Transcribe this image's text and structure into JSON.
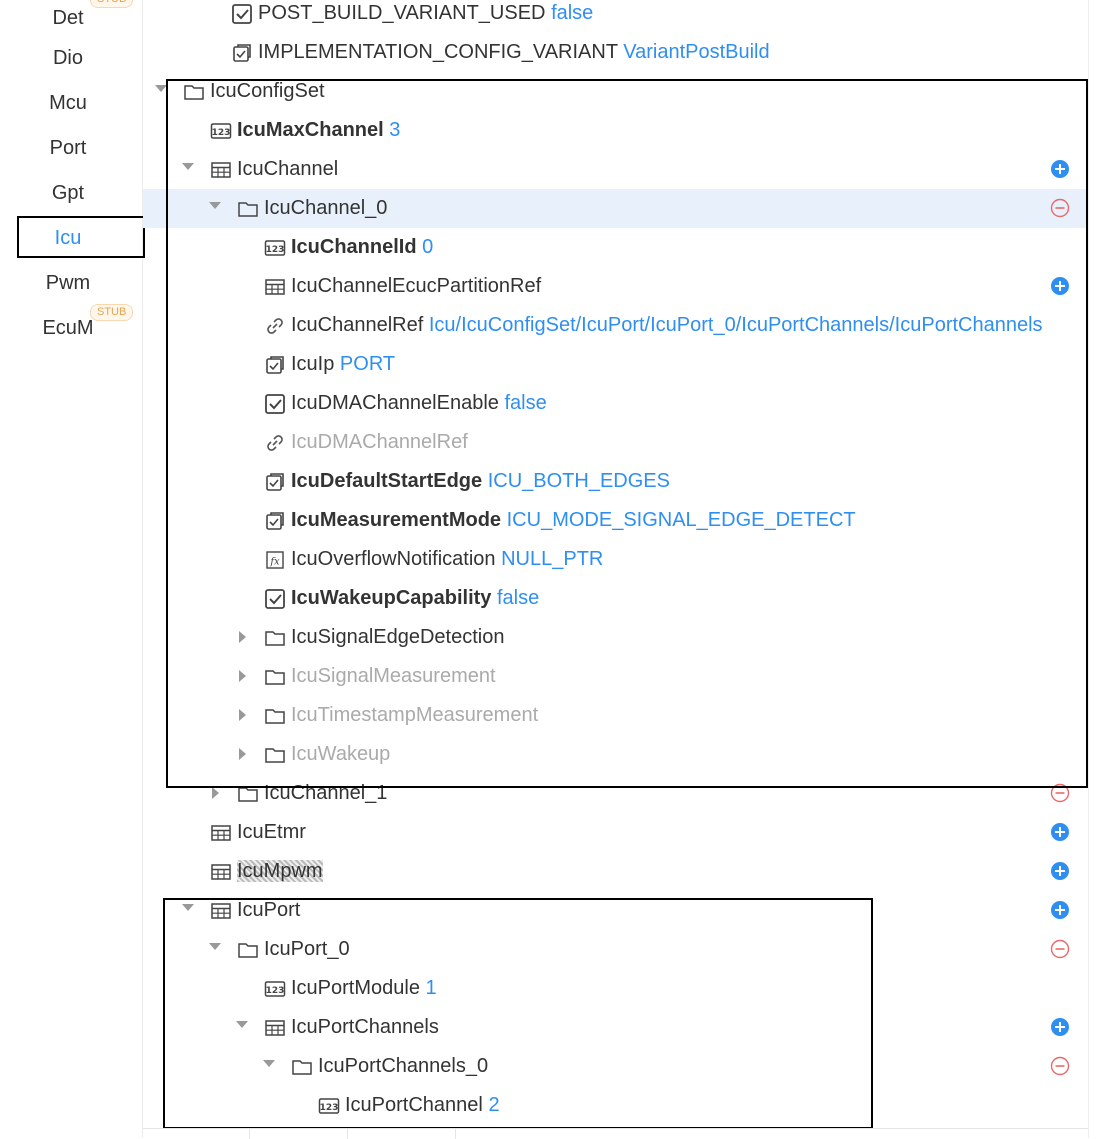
{
  "sidebar": {
    "items": [
      {
        "label": "Det",
        "stub": true
      },
      {
        "label": "Dio",
        "stub": false
      },
      {
        "label": "Mcu",
        "stub": false
      },
      {
        "label": "Port",
        "stub": false
      },
      {
        "label": "Gpt",
        "stub": false
      },
      {
        "label": "Icu",
        "stub": false,
        "active": true
      },
      {
        "label": "Pwm",
        "stub": false
      },
      {
        "label": "EcuM",
        "stub": true
      }
    ],
    "stub_label": "STUB"
  },
  "tree": [
    {
      "label": "POST_BUILD_VARIANT_USED",
      "value": "false",
      "icon": "checkbox-icon"
    },
    {
      "label": "IMPLEMENTATION_CONFIG_VARIANT",
      "value": "VariantPostBuild",
      "icon": "enum-icon"
    },
    {
      "label": "IcuConfigSet",
      "value": "",
      "icon": "folder-icon",
      "expanded": true
    },
    {
      "label": "IcuMaxChannel",
      "value": "3",
      "icon": "number-icon",
      "bold": true
    },
    {
      "label": "IcuChannel",
      "value": "",
      "icon": "table-icon",
      "expanded": true,
      "action": "add"
    },
    {
      "label": "IcuChannel_0",
      "value": "",
      "icon": "folder-icon",
      "expanded": true,
      "action": "remove",
      "selected": true
    },
    {
      "label": "IcuChannelId",
      "value": "0",
      "icon": "number-icon",
      "bold": true
    },
    {
      "label": "IcuChannelEcucPartitionRef",
      "value": "",
      "icon": "table-icon",
      "action": "add"
    },
    {
      "label": "IcuChannelRef",
      "value": "Icu/IcuConfigSet/IcuPort/IcuPort_0/IcuPortChannels/IcuPortChannels",
      "icon": "link-icon"
    },
    {
      "label": "IcuIp",
      "value": "PORT",
      "icon": "enum-icon"
    },
    {
      "label": "IcuDMAChannelEnable",
      "value": "false",
      "icon": "checkbox-icon"
    },
    {
      "label": "IcuDMAChannelRef",
      "value": "",
      "icon": "link-icon",
      "dim": true
    },
    {
      "label": "IcuDefaultStartEdge",
      "value": "ICU_BOTH_EDGES",
      "icon": "enum-icon",
      "bold": true
    },
    {
      "label": "IcuMeasurementMode",
      "value": "ICU_MODE_SIGNAL_EDGE_DETECT",
      "icon": "enum-icon",
      "bold": true
    },
    {
      "label": "IcuOverflowNotification",
      "value": "NULL_PTR",
      "icon": "function-icon"
    },
    {
      "label": "IcuWakeupCapability",
      "value": "false",
      "icon": "checkbox-icon",
      "bold": true
    },
    {
      "label": "IcuSignalEdgeDetection",
      "value": "",
      "icon": "folder-icon",
      "collapsed": true
    },
    {
      "label": "IcuSignalMeasurement",
      "value": "",
      "icon": "folder-icon",
      "collapsed": true,
      "dim": true
    },
    {
      "label": "IcuTimestampMeasurement",
      "value": "",
      "icon": "folder-icon",
      "collapsed": true,
      "dim": true
    },
    {
      "label": "IcuWakeup",
      "value": "",
      "icon": "folder-icon",
      "collapsed": true,
      "dim": true
    },
    {
      "label": "IcuChannel_1",
      "value": "",
      "icon": "folder-icon",
      "collapsed": true,
      "action": "remove"
    },
    {
      "label": "IcuEtmr",
      "value": "",
      "icon": "table-icon",
      "action": "add"
    },
    {
      "label": "IcuMpwm",
      "value": "",
      "icon": "table-icon",
      "action": "add",
      "obscured": true
    },
    {
      "label": "IcuPort",
      "value": "",
      "icon": "table-icon",
      "expanded": true,
      "action": "add"
    },
    {
      "label": "IcuPort_0",
      "value": "",
      "icon": "folder-icon",
      "expanded": true,
      "action": "remove"
    },
    {
      "label": "IcuPortModule",
      "value": "1",
      "icon": "number-icon"
    },
    {
      "label": "IcuPortChannels",
      "value": "",
      "icon": "table-icon",
      "expanded": true,
      "action": "add"
    },
    {
      "label": "IcuPortChannels_0",
      "value": "",
      "icon": "folder-icon",
      "expanded": true,
      "action": "remove"
    },
    {
      "label": "IcuPortChannel",
      "value": "2",
      "icon": "number-icon"
    }
  ],
  "colors": {
    "accent": "#2f8ff0",
    "remove": "#e96a6a",
    "selected_row": "#e8f1fb",
    "stub": "#e8a24a"
  }
}
